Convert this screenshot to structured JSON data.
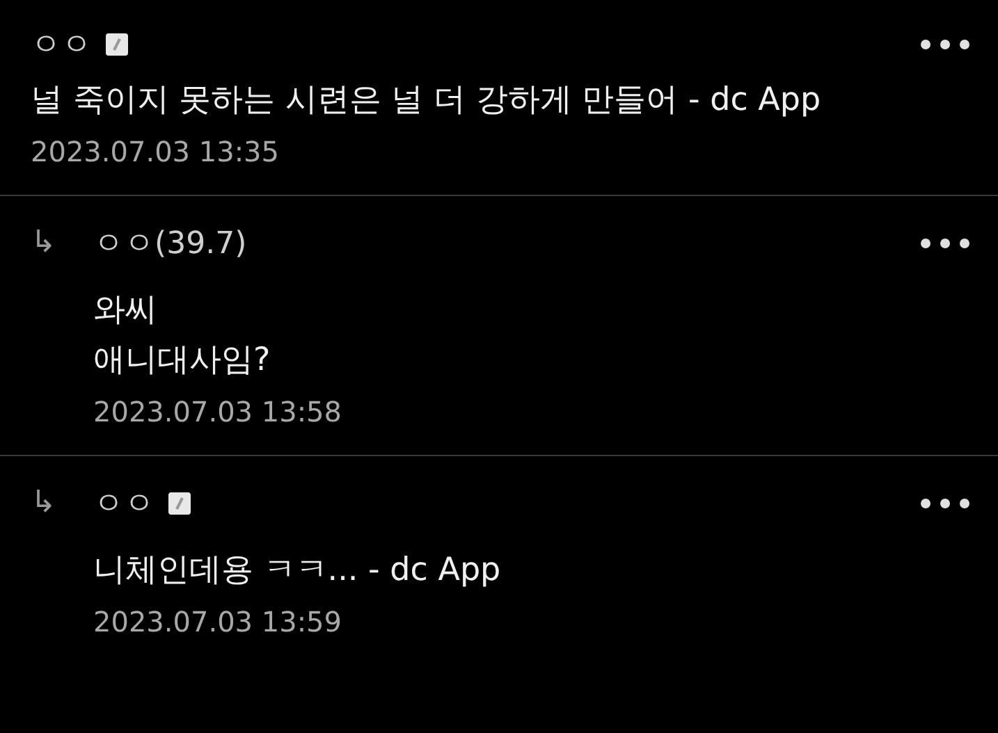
{
  "comments": [
    {
      "kind": "comment",
      "author": "ㅇㅇ",
      "badge": true,
      "body": "널 죽이지 못하는 시련은 널 더 강하게 만들어 - dc App",
      "date": "2023.07.03 13:35"
    },
    {
      "kind": "reply",
      "arrow": "↳",
      "author": "ㅇㅇ(39.7)",
      "badge": false,
      "body": "와씨\n애니대사임?",
      "date": "2023.07.03 13:58"
    },
    {
      "kind": "reply",
      "arrow": "↳",
      "author": "ㅇㅇ",
      "badge": true,
      "body": "니체인데용 ㅋㅋ... - dc App",
      "date": "2023.07.03 13:59"
    }
  ]
}
